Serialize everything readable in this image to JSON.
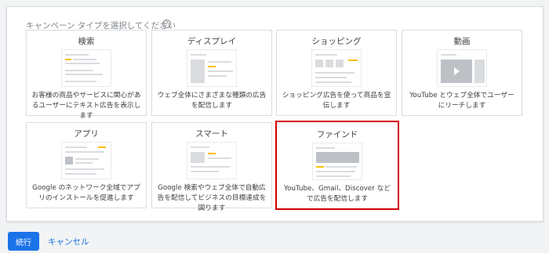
{
  "prompt": "キャンペーン タイプを選択してください",
  "help_icon": "?",
  "cards": [
    {
      "id": "search",
      "title": "検索",
      "desc": "お客様の商品やサービスに関心があるユーザーにテキスト広告を表示します",
      "selected": false
    },
    {
      "id": "display",
      "title": "ディスプレイ",
      "desc": "ウェブ全体にさまざまな種類の広告を配信します",
      "selected": false
    },
    {
      "id": "shopping",
      "title": "ショッピング",
      "desc": "ショッピング広告を使って商品を宣伝します",
      "selected": false
    },
    {
      "id": "video",
      "title": "動画",
      "desc": "YouTube とウェブ全体でユーザーにリーチします",
      "selected": false
    },
    {
      "id": "app",
      "title": "アプリ",
      "desc": "Google のネットワーク全域でアプリのインストールを促進します",
      "selected": false
    },
    {
      "id": "smart",
      "title": "スマート",
      "desc": "Google 検索やウェブ全体で自動広告を配信してビジネスの目標達成を図ります",
      "selected": false
    },
    {
      "id": "discovery",
      "title": "ファインド",
      "desc": "YouTube、Gmail、Discover などで広告を配信します",
      "selected": true
    }
  ],
  "continue_label": "続行",
  "cancel_label": "キャンセル",
  "colors": {
    "accent": "#1a73e8",
    "selection": "#d50000",
    "highlight": "#fbbc04"
  }
}
